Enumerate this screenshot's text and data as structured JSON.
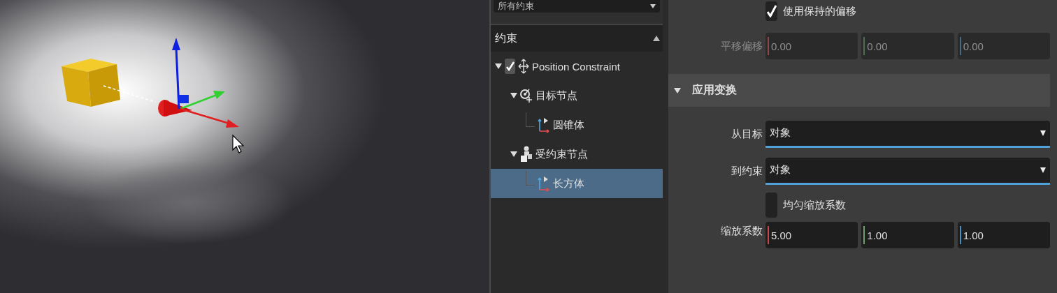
{
  "constraint_filter": {
    "value": "所有约束"
  },
  "tree": {
    "title": "约束",
    "items": [
      {
        "label": "Position Constraint",
        "kind": "constraint",
        "expanded": true,
        "checked": true,
        "selected": false,
        "children": [
          {
            "label": "目标节点",
            "kind": "target",
            "expanded": true,
            "selected": false,
            "children": [
              {
                "label": "圆锥体",
                "kind": "object",
                "selected": false
              }
            ]
          },
          {
            "label": "受约束节点",
            "kind": "constrained",
            "expanded": true,
            "selected": false,
            "children": [
              {
                "label": "长方体",
                "kind": "object",
                "selected": true
              }
            ]
          }
        ]
      }
    ]
  },
  "maintain_offset": {
    "label": "使用保持的偏移",
    "checked": true
  },
  "translate_offset": {
    "label": "平移偏移",
    "disabled": true,
    "fields": [
      {
        "value": "0.00",
        "color": "#8a4a4a"
      },
      {
        "value": "0.00",
        "color": "#4f6f52"
      },
      {
        "value": "0.00",
        "color": "#466a82"
      }
    ]
  },
  "apply_transform": {
    "title": "应用变换",
    "expanded": true,
    "from_target": {
      "label": "从目标",
      "value": "对象"
    },
    "to_constraint": {
      "label": "到约束",
      "value": "对象"
    },
    "scale": {
      "label": "缩放系数",
      "uniform": {
        "label": "均匀缩放系数",
        "checked": false
      },
      "fields": [
        {
          "value": "5.00",
          "color": "#c84848"
        },
        {
          "value": "1.00",
          "color": "#6fa070"
        },
        {
          "value": "1.00",
          "color": "#4a8ec0"
        }
      ]
    }
  }
}
